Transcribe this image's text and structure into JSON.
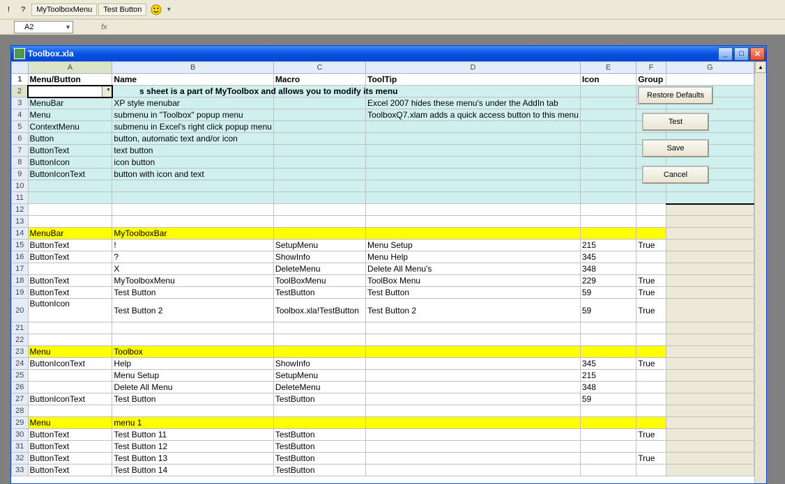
{
  "toolbar": {
    "btn1": "!",
    "btn2": "?",
    "btn3": "MyToolboxMenu",
    "btn4": "Test Button"
  },
  "namebox": "A2",
  "fx": "fx",
  "window_title": "Toolbox.xla",
  "columns": [
    "",
    "A",
    "B",
    "C",
    "D",
    "E",
    "F",
    "G"
  ],
  "col_headers": {
    "A": "Menu/Button",
    "B": "Name",
    "C": "Macro",
    "D": "ToolTip",
    "E": "Icon",
    "F": "Group"
  },
  "note_text": "s sheet is a part of MyToolbox and allows you to modify its menu",
  "buttons": {
    "restore": "Restore Defaults",
    "test": "Test",
    "save": "Save",
    "cancel": "Cancel"
  },
  "rows": [
    {
      "n": 1,
      "cls": "hdr-row",
      "A": "Menu/Button",
      "B": "Name",
      "C": "Macro",
      "D": "ToolTip",
      "E": "Icon",
      "F": "Group"
    },
    {
      "n": 2,
      "cls": "cyan",
      "A": "",
      "B": "",
      "C": "",
      "D": "",
      "E": "",
      "F": ""
    },
    {
      "n": 3,
      "cls": "cyan",
      "A": "MenuBar",
      "B": "XP style menubar",
      "C": "",
      "D": "Excel 2007 hides these menu's under the AddIn tab",
      "E": "",
      "F": ""
    },
    {
      "n": 4,
      "cls": "cyan",
      "A": "Menu",
      "B": "submenu in \"Toolbox\" popup menu",
      "C": "",
      "D": "ToolboxQ7.xlam adds a quick access button to this menu",
      "E": "",
      "F": ""
    },
    {
      "n": 5,
      "cls": "cyan",
      "A": "ContextMenu",
      "B": "submenu in Excel's right click popup menu",
      "C": "",
      "D": "",
      "E": "",
      "F": ""
    },
    {
      "n": 6,
      "cls": "cyan",
      "A": "Button",
      "B": "button, automatic text and/or icon",
      "C": "",
      "D": "",
      "E": "",
      "F": ""
    },
    {
      "n": 7,
      "cls": "cyan",
      "A": "ButtonText",
      "B": "text button",
      "C": "",
      "D": "",
      "E": "",
      "F": ""
    },
    {
      "n": 8,
      "cls": "cyan",
      "A": "ButtonIcon",
      "B": "icon button",
      "C": "",
      "D": "",
      "E": "",
      "F": ""
    },
    {
      "n": 9,
      "cls": "cyan",
      "A": "ButtonIconText",
      "B": "button with icon and text",
      "C": "",
      "D": "",
      "E": "",
      "F": ""
    },
    {
      "n": 10,
      "cls": "cyan",
      "A": "",
      "B": "",
      "C": "",
      "D": "",
      "E": "",
      "F": ""
    },
    {
      "n": 11,
      "cls": "cyan",
      "A": "",
      "B": "",
      "C": "",
      "D": "",
      "E": "",
      "F": ""
    },
    {
      "n": 12,
      "cls": "",
      "A": "",
      "B": "",
      "C": "",
      "D": "",
      "E": "",
      "F": ""
    },
    {
      "n": 13,
      "cls": "",
      "A": "",
      "B": "",
      "C": "",
      "D": "",
      "E": "",
      "F": ""
    },
    {
      "n": 14,
      "cls": "yellow",
      "A": "MenuBar",
      "B": "MyToolboxBar",
      "C": "",
      "D": "",
      "E": "",
      "F": ""
    },
    {
      "n": 15,
      "cls": "",
      "A": "ButtonText",
      "B": "!",
      "C": "SetupMenu",
      "D": "Menu Setup",
      "E": "215",
      "F": "True"
    },
    {
      "n": 16,
      "cls": "",
      "A": "ButtonText",
      "B": "?",
      "C": "ShowInfo",
      "D": "Menu Help",
      "E": "345",
      "F": ""
    },
    {
      "n": 17,
      "cls": "",
      "A": "",
      "B": "X",
      "C": "DeleteMenu",
      "D": "Delete All Menu's",
      "E": "348",
      "F": ""
    },
    {
      "n": 18,
      "cls": "",
      "A": "ButtonText",
      "B": "MyToolboxMenu",
      "C": "ToolBoxMenu",
      "D": "ToolBox Menu",
      "E": "229",
      "F": "True"
    },
    {
      "n": 19,
      "cls": "",
      "A": "ButtonText",
      "B": "Test Button",
      "C": "TestButton",
      "D": "Test Button",
      "E": "59",
      "F": "True"
    },
    {
      "n": 20,
      "cls": "",
      "A": "ButtonIcon",
      "B": "Test Button 2",
      "C": "Toolbox.xla!TestButton",
      "D": "Test Button 2",
      "E": "59",
      "F": "True"
    },
    {
      "n": 21,
      "cls": "",
      "A": "",
      "B": "",
      "C": "",
      "D": "",
      "E": "",
      "F": ""
    },
    {
      "n": 22,
      "cls": "",
      "A": "",
      "B": "",
      "C": "",
      "D": "",
      "E": "",
      "F": ""
    },
    {
      "n": 23,
      "cls": "yellow",
      "A": "Menu",
      "B": "Toolbox",
      "C": "",
      "D": "",
      "E": "",
      "F": ""
    },
    {
      "n": 24,
      "cls": "",
      "A": "ButtonIconText",
      "B": "Help",
      "C": "ShowInfo",
      "D": "",
      "E": "345",
      "F": "True"
    },
    {
      "n": 25,
      "cls": "",
      "A": "",
      "B": "Menu Setup",
      "C": "SetupMenu",
      "D": "",
      "E": "215",
      "F": ""
    },
    {
      "n": 26,
      "cls": "",
      "A": "",
      "B": "Delete All Menu",
      "C": "DeleteMenu",
      "D": "",
      "E": "348",
      "F": ""
    },
    {
      "n": 27,
      "cls": "",
      "A": "ButtonIconText",
      "B": "Test Button",
      "C": "TestButton",
      "D": "",
      "E": "59",
      "F": ""
    },
    {
      "n": 28,
      "cls": "",
      "A": "",
      "B": "",
      "C": "",
      "D": "",
      "E": "",
      "F": ""
    },
    {
      "n": 29,
      "cls": "yellow",
      "A": "Menu",
      "B": "menu 1",
      "C": "",
      "D": "",
      "E": "",
      "F": ""
    },
    {
      "n": 30,
      "cls": "",
      "A": "ButtonText",
      "B": "Test Button 11",
      "C": "TestButton",
      "D": "",
      "E": "",
      "F": "True"
    },
    {
      "n": 31,
      "cls": "",
      "A": "ButtonText",
      "B": "Test Button 12",
      "C": "TestButton",
      "D": "",
      "E": "",
      "F": ""
    },
    {
      "n": 32,
      "cls": "",
      "A": "ButtonText",
      "B": "Test Button 13",
      "C": "TestButton",
      "D": "",
      "E": "",
      "F": "True"
    },
    {
      "n": 33,
      "cls": "",
      "A": "ButtonText",
      "B": "Test Button 14",
      "C": "TestButton",
      "D": "",
      "E": "",
      "F": ""
    }
  ]
}
